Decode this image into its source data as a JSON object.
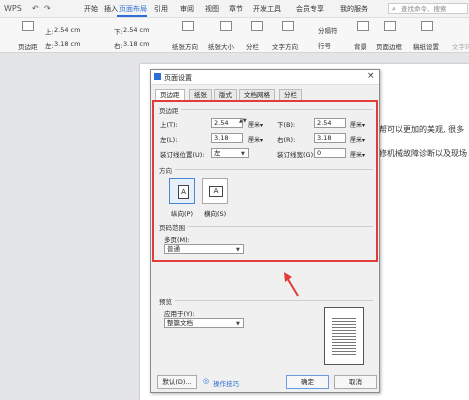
{
  "quick_access": [
    "WPS",
    "↶",
    "↷"
  ],
  "menu_tabs": [
    "开始",
    "插入",
    "页面布局",
    "引用",
    "审阅",
    "视图",
    "章节",
    "开发工具",
    "会员专享",
    "我的服务"
  ],
  "active_tab": "页面布局",
  "search_placeholder": "查找命令、搜索",
  "ribbon": {
    "top_margin_label": "上:",
    "top_margin_value": "2.54 cm",
    "bottom_margin_label": "下:",
    "bottom_margin_value": "2.54 cm",
    "left_margin_label": "左:",
    "left_margin_value": "3.18 cm",
    "right_margin_label": "右:",
    "right_margin_value": "3.18 cm",
    "margins_btn": "页边距",
    "orientation_btn": "纸张方向",
    "size_btn": "纸张大小",
    "columns_btn": "分栏",
    "text_direction_btn": "文字方向",
    "line_numbers_btn": "行号",
    "breaks_btn": "分隔符",
    "background_btn": "背景",
    "page_border_btn": "页面边框",
    "paper_margin_btn": "稿纸设置",
    "text_wrap_btn": "文字环绕"
  },
  "doc_text": [
    "帮可以更加的美观, 很多",
    "修机械故障诊断以及现场"
  ],
  "dialog": {
    "title": "页面设置",
    "tabs": [
      "页边距",
      "纸张",
      "版式",
      "文档网格",
      "分栏"
    ],
    "margins_section": "页边距",
    "top_label": "上(T):",
    "top_value": "2.54",
    "bottom_label": "下(B):",
    "bottom_value": "2.54",
    "left_label": "左(L):",
    "left_value": "3.18",
    "right_label": "右(R):",
    "right_value": "3.18",
    "unit": "厘米▾",
    "gutter_pos_label": "装订线位置(U):",
    "gutter_pos_value": "左",
    "gutter_width_label": "装订线宽(G):",
    "gutter_width_value": "0",
    "orientation_section": "方向",
    "portrait_label": "纵向(P)",
    "landscape_label": "横向(S)",
    "pages_section": "页码范围",
    "multi_pages_label": "多页(M):",
    "multi_pages_value": "普通",
    "preview_section": "预览",
    "apply_to_label": "应用于(Y):",
    "apply_to_value": "整篇文档",
    "default_btn": "默认(D)...",
    "tips_link": "操作技巧",
    "ok_btn": "确定",
    "cancel_btn": "取消"
  },
  "colors": {
    "accent": "#2b6fd6",
    "highlight": "#e23b3b"
  }
}
